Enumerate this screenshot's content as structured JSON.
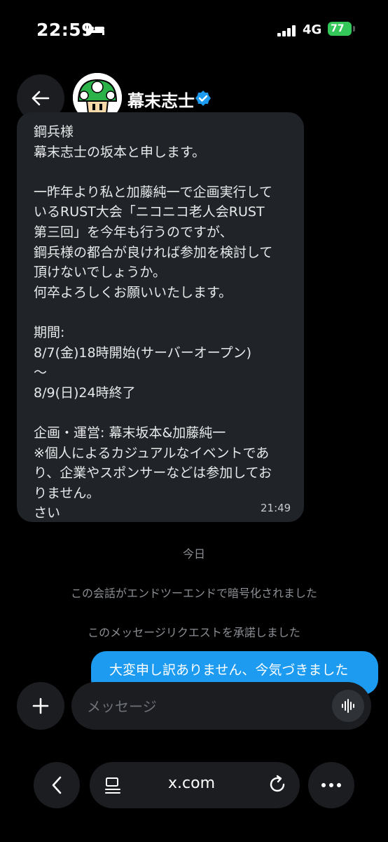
{
  "status_bar": {
    "time": "22:59",
    "network": "4G",
    "battery": "77"
  },
  "header": {
    "contact_name": "幕末志士",
    "back_icon": "arrow-left-icon",
    "verified_icon": "verified-badge-icon",
    "accent_color": "#1d9bf0"
  },
  "message": {
    "lines": [
      "鋼兵様",
      "幕末志士の坂本と申します。",
      "",
      "一昨年より私と加藤純一で企画実行して",
      "いるRUST大会「ニコニコ老人会RUST",
      "第三回」を今年も行うのですが、",
      "鋼兵様の都合が良ければ参加を検討して",
      "頂けないでしょうか。",
      "何卒よろしくお願いいたします。",
      "",
      "期間:",
      "8/7(金)18時開始(サーバーオープン)",
      "〜",
      "8/9(日)24時終了",
      "",
      "企画・運営: 幕末坂本&加藤純一",
      "※個人によるカジュアルなイベントであ",
      "り、企業やスポンサーなどは参加してお",
      "りません。",
      "さい"
    ],
    "time": "21:49"
  },
  "system": {
    "date_divider": "今日",
    "encrypted_notice": "この会話がエンドツーエンドで暗号化されました",
    "accepted_notice": "このメッセージリクエストを承諾しました"
  },
  "outgoing": {
    "text": "大変申し訳ありません、今気づきました"
  },
  "composer": {
    "placeholder": "メッセージ",
    "plus_icon": "plus-icon",
    "voice_icon": "voice-waveform-icon"
  },
  "browser": {
    "url": "x.com",
    "back_icon": "chevron-left-icon",
    "reader_icon": "reader-mode-icon",
    "reload_icon": "reload-icon",
    "more_icon": "more-dots-icon"
  }
}
